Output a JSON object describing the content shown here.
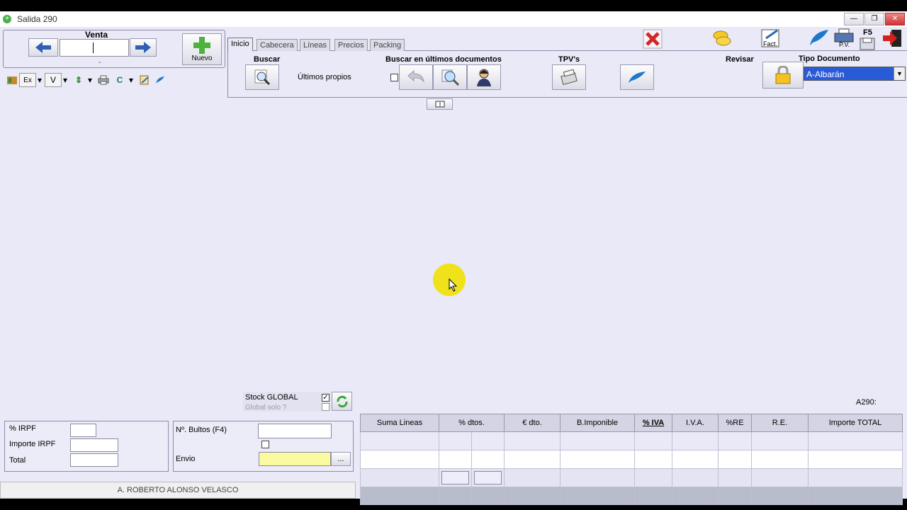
{
  "window": {
    "title": "Salida 290"
  },
  "nav": {
    "title": "Venta",
    "doc_number": "",
    "sub": "-",
    "new_label": "Nuevo"
  },
  "toolbar_small": {
    "ex": "Ex",
    "v": "V",
    "c": "C"
  },
  "tabs": [
    {
      "label": "Inicio",
      "active": true
    },
    {
      "label": "Cabecera"
    },
    {
      "label": "Líneas"
    },
    {
      "label": "Precios"
    },
    {
      "label": "Packing"
    }
  ],
  "ribbon": {
    "buscar": "Buscar",
    "ultimos_propios": "Últimos propios",
    "buscar_ultimos": "Buscar en últimos documentos",
    "tpvs": "TPV's",
    "revisar": "Revisar",
    "tipo_documento": "Tipo Documento",
    "tipo_value": "A-Albarán"
  },
  "top_icons": {
    "fact": "Fact.",
    "f5": "F5",
    "pv": "P.V."
  },
  "stock": {
    "label": "Stock GLOBAL",
    "sub": "Global solo ?",
    "checked": true
  },
  "doc_code": "A290:",
  "irpf": {
    "pct_label": "% IRPF",
    "importe_label": "Importe IRPF",
    "total_label": "Total"
  },
  "bultos": {
    "label": "Nº. Bultos (F4)",
    "envio_label": "Envio",
    "ellipsis": "..."
  },
  "client_name": "A. ROBERTO ALONSO VELASCO",
  "totals": {
    "columns": [
      "Suma Lineas",
      "% dtos.",
      "€ dto.",
      "B.Imponible",
      "% IVA",
      "I.V.A.",
      "%RE",
      "R.E.",
      "Importe TOTAL"
    ]
  },
  "colors": {
    "accent": "#2a5bd7",
    "background": "#e9e9f7",
    "envio_field": "#fafaa0"
  }
}
